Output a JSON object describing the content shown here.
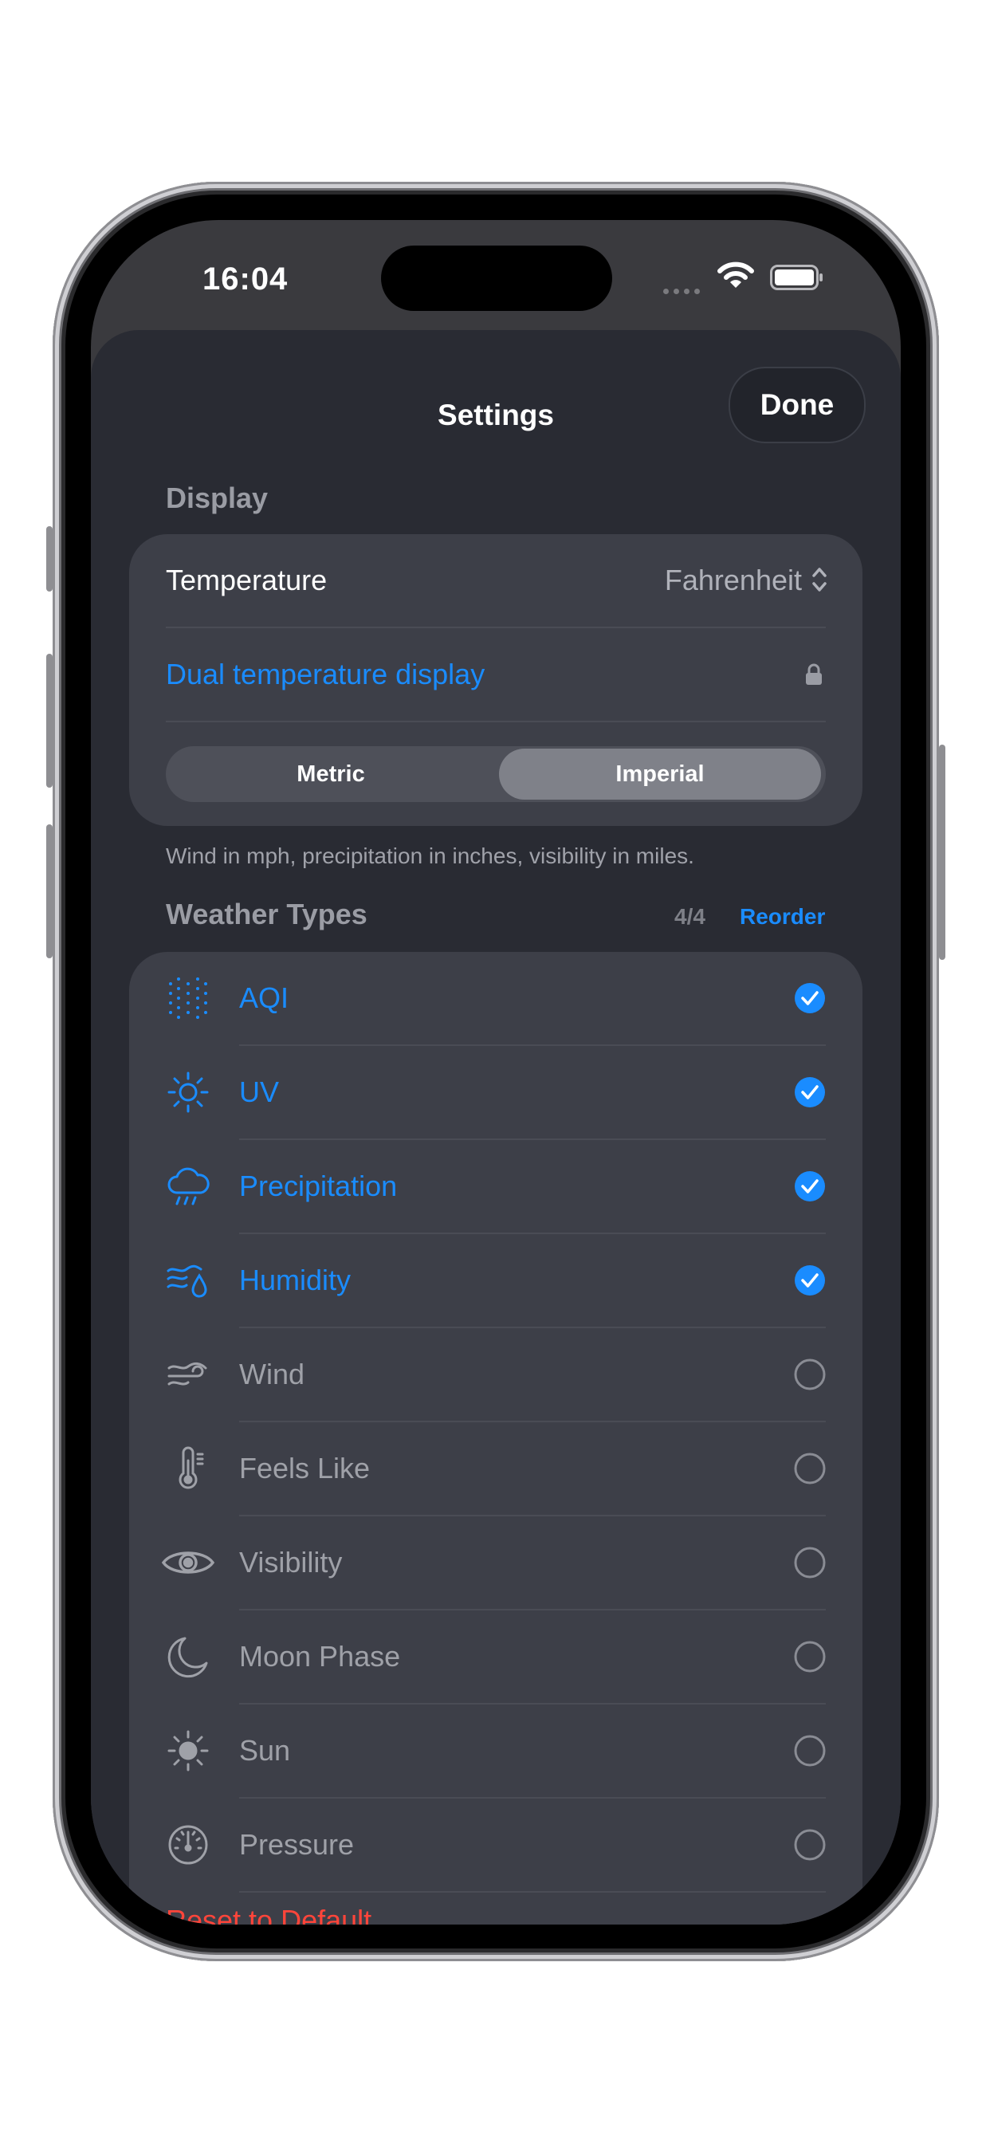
{
  "status_bar": {
    "time": "16:04"
  },
  "header": {
    "title": "Settings",
    "done_label": "Done"
  },
  "display": {
    "section_label": "Display",
    "temperature_label": "Temperature",
    "temperature_value": "Fahrenheit",
    "dual_label": "Dual temperature display",
    "units_options": [
      "Metric",
      "Imperial"
    ],
    "units_selected": "Imperial",
    "footnote": "Wind in mph, precipitation in inches, visibility in miles."
  },
  "weather_types": {
    "section_label": "Weather Types",
    "counter": "4/4",
    "reorder_label": "Reorder",
    "items": [
      {
        "label": "AQI",
        "icon": "aqi-dots-icon",
        "checked": true
      },
      {
        "label": "UV",
        "icon": "sun-icon",
        "checked": true
      },
      {
        "label": "Precipitation",
        "icon": "cloud-rain-icon",
        "checked": true
      },
      {
        "label": "Humidity",
        "icon": "humidity-icon",
        "checked": true
      },
      {
        "label": "Wind",
        "icon": "wind-icon",
        "checked": false
      },
      {
        "label": "Feels Like",
        "icon": "thermometer-icon",
        "checked": false
      },
      {
        "label": "Visibility",
        "icon": "eye-icon",
        "checked": false
      },
      {
        "label": "Moon Phase",
        "icon": "moon-icon",
        "checked": false
      },
      {
        "label": "Sun",
        "icon": "sun-filled-icon",
        "checked": false
      },
      {
        "label": "Pressure",
        "icon": "gauge-icon",
        "checked": false
      }
    ]
  },
  "reset_label": "Reset to Default",
  "colors": {
    "accent": "#1a8cff",
    "destructive": "#ff453a",
    "sheet_bg": "#292b33",
    "card_bg": "#3d3f48"
  }
}
